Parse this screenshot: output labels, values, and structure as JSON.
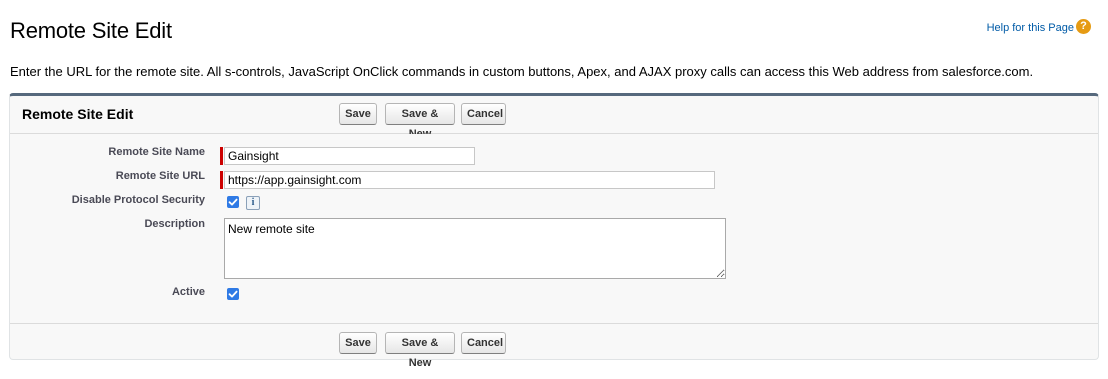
{
  "header": {
    "title": "Remote Site Edit",
    "help_link": "Help for this Page",
    "help_icon": "question-icon",
    "help_icon_glyph": "?"
  },
  "intro": "Enter the URL for the remote site. All s-controls, JavaScript OnClick commands in custom buttons, Apex, and AJAX proxy calls can access this Web address from salesforce.com.",
  "panel": {
    "title": "Remote Site Edit",
    "buttons": {
      "save": "Save",
      "save_new": "Save & New",
      "cancel": "Cancel"
    }
  },
  "form": {
    "remote_site_name": {
      "label": "Remote Site Name",
      "value": "Gainsight",
      "required": true
    },
    "remote_site_url": {
      "label": "Remote Site URL",
      "value": "https://app.gainsight.com",
      "required": true
    },
    "disable_protocol_security": {
      "label": "Disable Protocol Security",
      "checked": true,
      "info_glyph": "i"
    },
    "description": {
      "label": "Description",
      "value": "New remote site"
    },
    "active": {
      "label": "Active",
      "checked": true
    }
  },
  "colors": {
    "panel_border_top": "#56697d",
    "required_bar": "#cc0000",
    "checkbox": "#2f7ae5",
    "help_icon": "#e69b13",
    "link": "#015ba7"
  }
}
